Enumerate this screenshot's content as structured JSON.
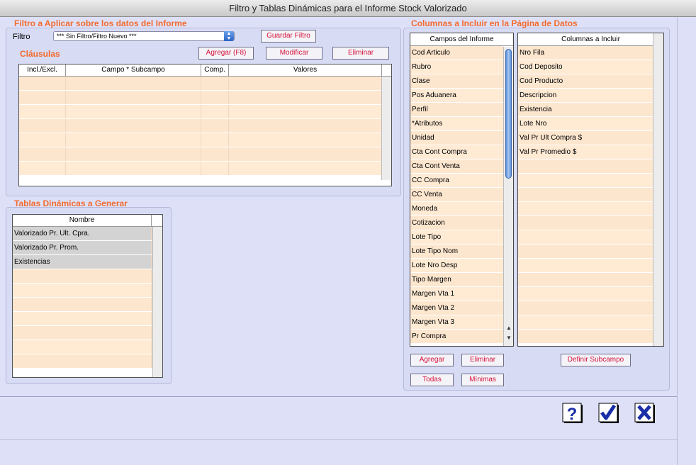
{
  "window": {
    "title": "Filtro y Tablas Dinámicas para el Informe Stock Valorizado"
  },
  "filter_section": {
    "title": "Filtro a Aplicar sobre los datos del Informe",
    "filter_label": "Filtro",
    "filter_value": "*** Sin Filtro/Filtro Nuevo ***",
    "save_button": "Guardar Filtro",
    "clauses_title": "Cláusulas",
    "add_button": "Agregar (F8)",
    "modify_button": "Modificar",
    "delete_button": "Eliminar",
    "columns": [
      "Incl./Excl.",
      "Campo * Subcampo",
      "Comp.",
      "Valores"
    ]
  },
  "pivot_section": {
    "title": "Tablas Dinámicas a Generar",
    "column": "Nombre",
    "items": [
      "Valorizado Pr. Ult. Cpra.",
      "Valorizado Pr. Prom.",
      "Existencias"
    ]
  },
  "columns_section": {
    "title": "Columnas a Incluir en la Página de Datos",
    "fields_header": "Campos del Informe",
    "fields": [
      "Cod Articulo",
      "Rubro",
      "Clase",
      "Pos Aduanera",
      "Perfil",
      "*Atributos",
      "Unidad",
      "Cta Cont Compra",
      "Cta Cont Venta",
      "CC Compra",
      "CC Venta",
      "Moneda",
      "Cotizacion",
      "Lote Tipo",
      "Lote Tipo Nom",
      "Lote Nro Desp",
      "Tipo Margen",
      "Margen Vta 1",
      "Margen Vta 2",
      "Margen Vta 3",
      "Pr Compra"
    ],
    "included_header": "Columnas a Incluir",
    "included": [
      "Nro Fila",
      "Cod Deposito",
      "Cod Producto",
      "Descripcion",
      "Existencia",
      "Lote Nro",
      "Val Pr Ult Compra $",
      "Val Pr Promedio $"
    ],
    "add_button": "Agregar",
    "remove_button": "Eliminar",
    "all_button": "Todas",
    "minimal_button": "Mínimas",
    "define_subfield_button": "Definir Subcampo"
  },
  "icons": {
    "help": "question-icon",
    "ok": "check-icon",
    "cancel": "x-icon"
  },
  "colors": {
    "accent": "#f26b2f",
    "button_text": "#d4103a",
    "row_peach": "#fde6ce",
    "selected_row": "#d3d3d3"
  }
}
